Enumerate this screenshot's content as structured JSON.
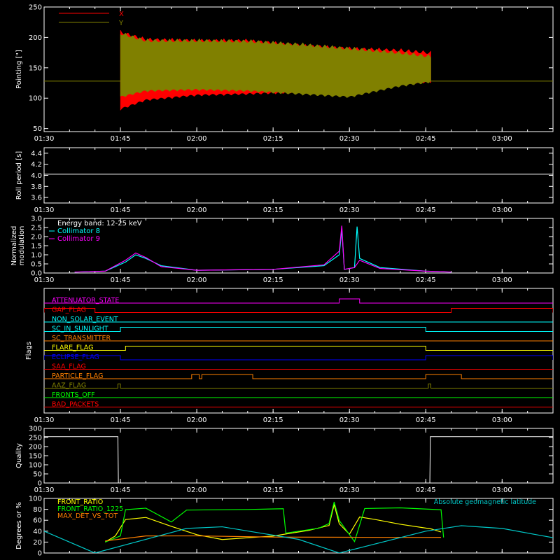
{
  "time_axis": {
    "start": "01:30",
    "end": "03:10",
    "ticks": [
      "01:30",
      "01:45",
      "02:00",
      "02:15",
      "02:30",
      "02:45",
      "03:00"
    ]
  },
  "colors": {
    "axes": "#ffffff",
    "x_series": "#ff0000",
    "y_series": "#808000",
    "collimator8": "#00ffff",
    "collimator9": "#ff00ff",
    "front_ratio": "#ffff00",
    "front_ratio_1225": "#00ff00",
    "max_det": "#ff8000",
    "geomag": "#00c8c8"
  },
  "chart_data": [
    {
      "type": "area",
      "ylabel": "Pointing [\"]",
      "ylim": [
        45,
        250
      ],
      "yticks": [
        50,
        100,
        150,
        200,
        250
      ],
      "legend": {
        "placement": "top-left"
      },
      "baseline": 128,
      "active_window": [
        "01:45",
        "02:46"
      ],
      "series": [
        {
          "name": "X",
          "color": "#ff0000",
          "envelope": [
            {
              "t": "01:45",
              "min": 80,
              "max": 212
            },
            {
              "t": "01:50",
              "min": 95,
              "max": 200
            },
            {
              "t": "02:00",
              "min": 103,
              "max": 198
            },
            {
              "t": "02:10",
              "min": 105,
              "max": 198
            },
            {
              "t": "02:20",
              "min": 108,
              "max": 190
            },
            {
              "t": "02:30",
              "min": 115,
              "max": 185
            },
            {
              "t": "02:40",
              "min": 122,
              "max": 182
            },
            {
              "t": "02:46",
              "min": 125,
              "max": 178
            }
          ]
        },
        {
          "name": "Y",
          "color": "#808000",
          "envelope": [
            {
              "t": "01:45",
              "min": 100,
              "max": 210
            },
            {
              "t": "01:50",
              "min": 110,
              "max": 198
            },
            {
              "t": "02:00",
              "min": 112,
              "max": 198
            },
            {
              "t": "02:10",
              "min": 110,
              "max": 197
            },
            {
              "t": "02:20",
              "min": 105,
              "max": 192
            },
            {
              "t": "02:30",
              "min": 100,
              "max": 185
            },
            {
              "t": "02:40",
              "min": 118,
              "max": 178
            },
            {
              "t": "02:46",
              "min": 125,
              "max": 172
            }
          ]
        }
      ]
    },
    {
      "type": "line",
      "ylabel": "Roll period [s]",
      "ylim": [
        3.5,
        4.5
      ],
      "yticks": [
        3.6,
        3.8,
        4.0,
        4.2,
        4.4
      ],
      "series": [
        {
          "color": "#ffffff",
          "points": [
            {
              "t": "01:30",
              "y": 4.02
            },
            {
              "t": "03:10",
              "y": 4.02
            }
          ]
        }
      ]
    },
    {
      "type": "line",
      "ylabel": "Normalized modulation",
      "ylim": [
        0,
        3.0
      ],
      "yticks": [
        0.0,
        0.5,
        1.0,
        1.5,
        2.0,
        2.5,
        3.0
      ],
      "annotation": "Energy band: 12-25 keV",
      "series": [
        {
          "name": "Collimator 8",
          "color": "#00ffff",
          "points": [
            {
              "t": "01:36",
              "y": 0.05
            },
            {
              "t": "01:42",
              "y": 0.1
            },
            {
              "t": "01:46",
              "y": 0.6
            },
            {
              "t": "01:48",
              "y": 1.0
            },
            {
              "t": "01:50",
              "y": 0.8
            },
            {
              "t": "01:53",
              "y": 0.4
            },
            {
              "t": "02:00",
              "y": 0.15
            },
            {
              "t": "02:15",
              "y": 0.2
            },
            {
              "t": "02:25",
              "y": 0.4
            },
            {
              "t": "02:28",
              "y": 1.0
            },
            {
              "t": "02:28.5",
              "y": 2.4
            },
            {
              "t": "02:29",
              "y": 0.2
            },
            {
              "t": "02:31",
              "y": 0.3
            },
            {
              "t": "02:31.5",
              "y": 2.55
            },
            {
              "t": "02:32",
              "y": 0.8
            },
            {
              "t": "02:36",
              "y": 0.3
            },
            {
              "t": "02:45",
              "y": 0.1
            },
            {
              "t": "02:50",
              "y": 0.05
            }
          ]
        },
        {
          "name": "Collimator 9",
          "color": "#ff00ff",
          "points": [
            {
              "t": "01:36",
              "y": 0.05
            },
            {
              "t": "01:42",
              "y": 0.1
            },
            {
              "t": "01:46",
              "y": 0.7
            },
            {
              "t": "01:48",
              "y": 1.1
            },
            {
              "t": "01:50",
              "y": 0.85
            },
            {
              "t": "01:53",
              "y": 0.35
            },
            {
              "t": "02:00",
              "y": 0.15
            },
            {
              "t": "02:15",
              "y": 0.2
            },
            {
              "t": "02:25",
              "y": 0.45
            },
            {
              "t": "02:28",
              "y": 1.2
            },
            {
              "t": "02:28.5",
              "y": 2.6
            },
            {
              "t": "02:29",
              "y": 0.2
            },
            {
              "t": "02:31",
              "y": 0.3
            },
            {
              "t": "02:32",
              "y": 0.7
            },
            {
              "t": "02:36",
              "y": 0.25
            },
            {
              "t": "02:45",
              "y": 0.1
            },
            {
              "t": "02:50",
              "y": 0.05
            }
          ]
        }
      ]
    },
    {
      "type": "table",
      "ylabel": "Flags",
      "flags": [
        {
          "name": "ATTENUATOR_STATE",
          "color": "#ff00ff",
          "on": [
            [
              "02:28",
              "02:32"
            ]
          ]
        },
        {
          "name": "GAP_FLAG",
          "color": "#ff0000",
          "on": [
            [
              "01:30",
              "01:40"
            ],
            [
              "02:50",
              "03:10"
            ]
          ]
        },
        {
          "name": "NON_SOLAR_EVENT",
          "color": "#00ffff",
          "on": []
        },
        {
          "name": "SC_IN_SUNLIGHT",
          "color": "#00ffff",
          "on": [
            [
              "01:45",
              "02:45"
            ]
          ]
        },
        {
          "name": "SC_TRANSMITTER",
          "color": "#ff8000",
          "on": []
        },
        {
          "name": "FLARE_FLAG",
          "color": "#ffff00",
          "on": [
            [
              "01:46",
              "02:45"
            ]
          ]
        },
        {
          "name": "ECLIPSE_FLAG",
          "color": "#0000ff",
          "on": [
            [
              "01:30",
              "01:45"
            ],
            [
              "02:45",
              "03:10"
            ]
          ]
        },
        {
          "name": "SAA_FLAG",
          "color": "#ff0000",
          "on": []
        },
        {
          "name": "PARTICLE_FLAG",
          "color": "#ff8000",
          "on": [
            [
              "01:59",
              "02:00.5"
            ],
            [
              "02:01",
              "02:11"
            ],
            [
              "02:45",
              "02:52"
            ]
          ]
        },
        {
          "name": "AAZ_FLAG",
          "color": "#808000",
          "on": [
            [
              "01:44.5",
              "01:45"
            ],
            [
              "02:45.5",
              "02:46"
            ]
          ]
        },
        {
          "name": "FRONTS_OFF",
          "color": "#00ff00",
          "on": []
        },
        {
          "name": "BAD_PACKETS",
          "color": "#ff0000",
          "on": []
        }
      ]
    },
    {
      "type": "line",
      "ylabel": "Quality",
      "ylim": [
        0,
        300
      ],
      "yticks": [
        0,
        50,
        100,
        150,
        200,
        250,
        300
      ],
      "series": [
        {
          "color": "#ffffff",
          "points": [
            {
              "t": "01:30",
              "y": 255
            },
            {
              "t": "01:44.5",
              "y": 255
            },
            {
              "t": "01:44.6",
              "y": 0
            },
            {
              "t": "02:45.8",
              "y": 0
            },
            {
              "t": "02:45.9",
              "y": 255
            },
            {
              "t": "03:10",
              "y": 255
            }
          ]
        }
      ]
    },
    {
      "type": "line",
      "ylabel": "Degrees or %",
      "ylim": [
        0,
        100
      ],
      "yticks": [
        0,
        20,
        40,
        60,
        80,
        100
      ],
      "series": [
        {
          "name": "FRONT_RATIO",
          "color": "#ffff00",
          "points": [
            {
              "t": "01:42",
              "y": 20
            },
            {
              "t": "01:44",
              "y": 30
            },
            {
              "t": "01:46",
              "y": 60
            },
            {
              "t": "01:50",
              "y": 65
            },
            {
              "t": "01:55",
              "y": 50
            },
            {
              "t": "02:00",
              "y": 35
            },
            {
              "t": "02:05",
              "y": 25
            },
            {
              "t": "02:15",
              "y": 30
            },
            {
              "t": "02:22",
              "y": 40
            },
            {
              "t": "02:26",
              "y": 50
            },
            {
              "t": "02:27",
              "y": 90
            },
            {
              "t": "02:28",
              "y": 55
            },
            {
              "t": "02:30",
              "y": 35
            },
            {
              "t": "02:32",
              "y": 65
            },
            {
              "t": "02:35",
              "y": 60
            },
            {
              "t": "02:40",
              "y": 52
            },
            {
              "t": "02:46",
              "y": 45
            },
            {
              "t": "02:48",
              "y": 40
            }
          ]
        },
        {
          "name": "FRONT_RATIO_1225",
          "color": "#00ff00",
          "points": [
            {
              "t": "01:42",
              "y": 20
            },
            {
              "t": "01:45",
              "y": 30
            },
            {
              "t": "01:46",
              "y": 78
            },
            {
              "t": "01:50",
              "y": 82
            },
            {
              "t": "01:55",
              "y": 58
            },
            {
              "t": "01:58",
              "y": 80
            },
            {
              "t": "02:10",
              "y": 80
            },
            {
              "t": "02:17",
              "y": 80
            },
            {
              "t": "02:17.5",
              "y": 35
            },
            {
              "t": "02:24",
              "y": 45
            },
            {
              "t": "02:26",
              "y": 55
            },
            {
              "t": "02:27",
              "y": 95
            },
            {
              "t": "02:28",
              "y": 60
            },
            {
              "t": "02:31",
              "y": 20
            },
            {
              "t": "02:33",
              "y": 80
            },
            {
              "t": "02:40",
              "y": 82
            },
            {
              "t": "02:48",
              "y": 80
            },
            {
              "t": "02:48.5",
              "y": 30
            }
          ]
        },
        {
          "name": "MAX_DET_VS_TOT",
          "color": "#ff8000",
          "points": [
            {
              "t": "01:42",
              "y": 22
            },
            {
              "t": "01:50",
              "y": 30
            },
            {
              "t": "02:00",
              "y": 30
            },
            {
              "t": "02:15",
              "y": 29
            },
            {
              "t": "02:30",
              "y": 30
            },
            {
              "t": "02:45",
              "y": 30
            },
            {
              "t": "02:48",
              "y": 29
            }
          ]
        },
        {
          "name": "Absolute geomagnetic latitude",
          "color": "#00c8c8",
          "points": [
            {
              "t": "01:30",
              "y": 40
            },
            {
              "t": "01:40",
              "y": 0
            },
            {
              "t": "01:58",
              "y": 45
            },
            {
              "t": "02:05",
              "y": 48
            },
            {
              "t": "02:20",
              "y": 25
            },
            {
              "t": "02:28",
              "y": 0
            },
            {
              "t": "02:45",
              "y": 40
            },
            {
              "t": "02:52",
              "y": 50
            },
            {
              "t": "03:00",
              "y": 45
            },
            {
              "t": "03:10",
              "y": 28
            }
          ]
        }
      ]
    }
  ]
}
